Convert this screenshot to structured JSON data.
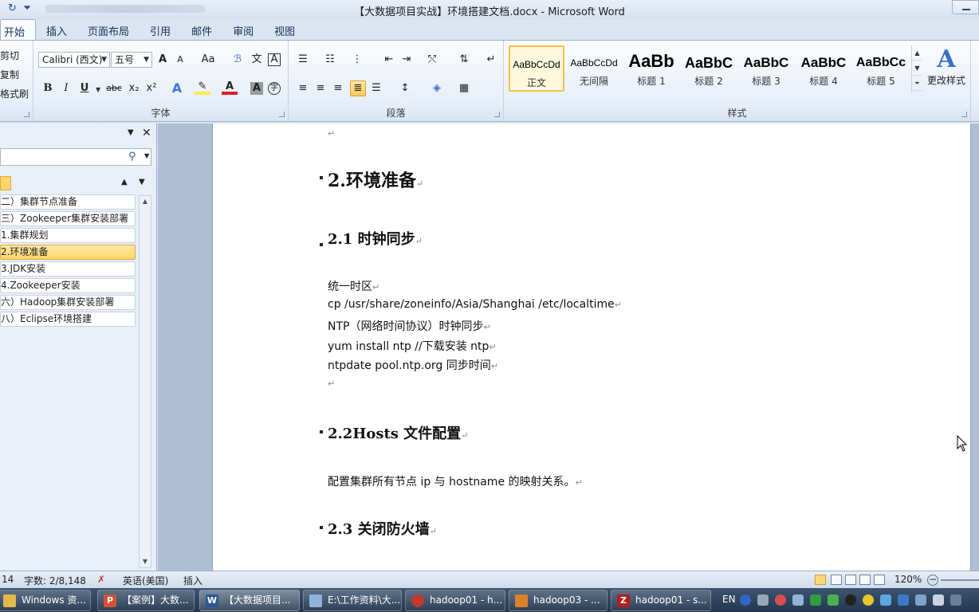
{
  "window": {
    "title": "【大数据项目实战】环境搭建文档.docx - Microsoft Word"
  },
  "ribbon": {
    "tabs": [
      "开始",
      "插入",
      "页面布局",
      "引用",
      "邮件",
      "审阅",
      "视图"
    ],
    "clipboard": {
      "cut": "剪切",
      "copy": "复制",
      "format_painter": "格式刷"
    },
    "font": {
      "group_label": "字体",
      "font_name": "Calibri (西文)",
      "font_size": "五号",
      "bold": "B",
      "italic": "I",
      "underline": "U",
      "strike": "abc",
      "subscript": "x₂",
      "superscript": "x²",
      "grow": "A",
      "shrink": "A",
      "change_case": "Aa"
    },
    "paragraph": {
      "group_label": "段落"
    },
    "styles": {
      "group_label": "样式",
      "items": [
        {
          "preview": "AaBbCcDd",
          "name": "正文"
        },
        {
          "preview": "AaBbCcDd",
          "name": "无间隔"
        },
        {
          "preview": "AaBb",
          "name": "标题 1"
        },
        {
          "preview": "AaBbC",
          "name": "标题 2"
        },
        {
          "preview": "AaBbC",
          "name": "标题 3"
        },
        {
          "preview": "AaBbC",
          "name": "标题 4"
        },
        {
          "preview": "AaBbCc",
          "name": "标题 5"
        }
      ],
      "change_styles": "更改样式"
    }
  },
  "nav": {
    "items": [
      "二）集群节点准备",
      "三）Zookeeper集群安装部署",
      "1.集群规划",
      "2.环境准备",
      "3.JDK安装",
      "4.Zookeeper安装",
      "六）Hadoop集群安装部署",
      "八）Eclipse环境搭建"
    ],
    "active_index": 3
  },
  "document": {
    "h1": "2.环境准备",
    "h2_1": "2.1 时钟同步",
    "lines": [
      "统一时区",
      "cp /usr/share/zoneinfo/Asia/Shanghai /etc/localtime",
      "NTP（网络时间协议）时钟同步",
      "yum install ntp   //下载安装 ntp",
      "ntpdate pool.ntp.org  同步时间"
    ],
    "h2_2": "2.2Hosts 文件配置",
    "hosts_text": "配置集群所有节点 ip 与 hostname 的映射关系。",
    "h2_3": "2.3 关闭防火墙"
  },
  "statusbar": {
    "page": "14",
    "words": "字数: 2/8,148",
    "language": "英语(美国)",
    "mode": "插入",
    "zoom": "120%"
  },
  "taskbar": {
    "items": [
      {
        "label": "Windows 资...",
        "icon": "folder-icon",
        "color": "#e4b84a"
      },
      {
        "label": "【案例】大数...",
        "icon": "powerpoint-icon",
        "color": "#d35230"
      },
      {
        "label": "【大数据项目...",
        "icon": "word-icon",
        "color": "#2b5797"
      },
      {
        "label": "E:\\工作资料\\大...",
        "icon": "notepad-icon",
        "color": "#8fb3d9"
      },
      {
        "label": "hadoop01 - h...",
        "icon": "browser-icon",
        "color": "#c0392b"
      },
      {
        "label": "hadoop03 - ...",
        "icon": "terminal-icon",
        "color": "#d9822b"
      },
      {
        "label": "hadoop01 - s...",
        "icon": "filezilla-icon",
        "color": "#b11f1f"
      }
    ],
    "lang": "EN"
  }
}
